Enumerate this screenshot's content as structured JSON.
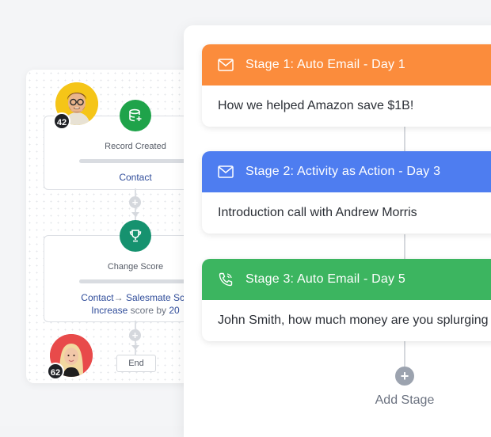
{
  "workflow": {
    "node1": {
      "title": "Record Created",
      "link": "Contact"
    },
    "node2": {
      "title": "Change Score",
      "line1_a": "Contact",
      "line1_arrow": "→",
      "line1_b": "Salesmate Sco",
      "line2_a": "Increase",
      "line2_b": "score by",
      "line2_c": "20"
    },
    "end_label": "End",
    "plus_symbol": "+",
    "avatar_top_badge": "42",
    "avatar_bottom_badge": "62",
    "icon_colors": {
      "record": "#1fa34a",
      "score": "#16926f"
    }
  },
  "stages": [
    {
      "title": "Stage 1: Auto Email - Day 1",
      "body": "How we helped Amazon save $1B!",
      "icon": "mail-icon",
      "color": "#fb8c3c"
    },
    {
      "title": "Stage 2: Activity as Action - Day 3",
      "body": "Introduction call with Andrew Morris",
      "icon": "mail-icon",
      "color": "#4e7df0"
    },
    {
      "title": "Stage 3: Auto Email - Day 5",
      "body": "John Smith, how much money are you splurging",
      "icon": "phone-icon",
      "color": "#3cb560"
    }
  ],
  "add_stage": {
    "label": "Add Stage",
    "symbol": "+"
  }
}
